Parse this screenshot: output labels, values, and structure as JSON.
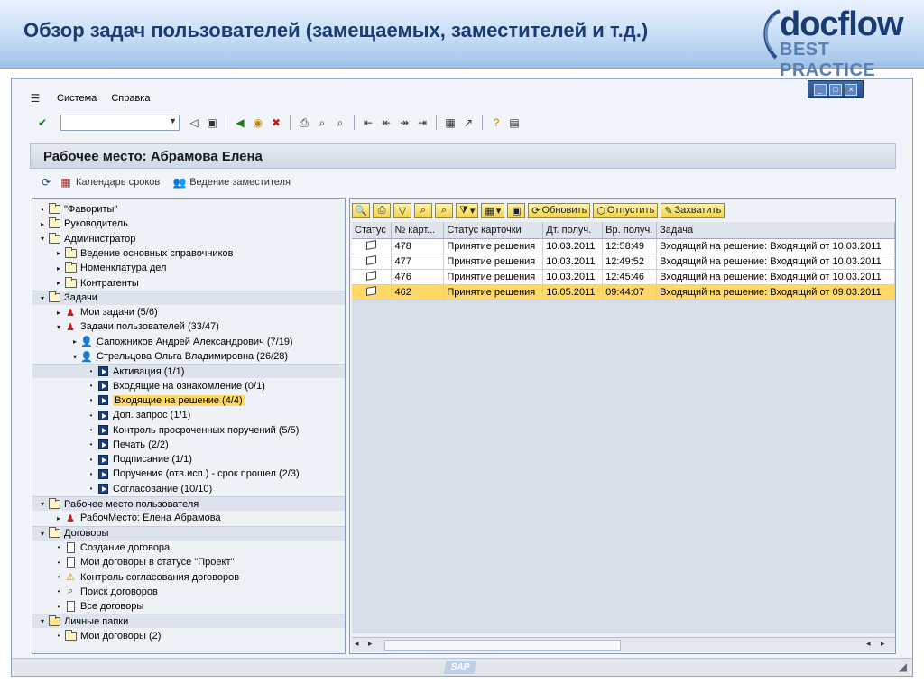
{
  "slide": {
    "title": "Обзор задач пользователей (замещаемых, заместителей и т.д.)",
    "logo_main": "docflow",
    "logo_sub": "BEST PRACTICE"
  },
  "menu": {
    "system": "Система",
    "help": "Справка"
  },
  "screen_title": "Рабочее место: Абрамова Елена",
  "app_toolbar": {
    "calendar": "Календарь сроков",
    "deputy": "Ведение заместителя"
  },
  "tree": [
    {
      "label": "\"Фавориты\"",
      "toggle": "•",
      "icon": "folder",
      "indent": 0,
      "group": false
    },
    {
      "label": "Руководитель",
      "toggle": "▸",
      "icon": "folder",
      "indent": 0,
      "group": false
    },
    {
      "label": "Администратор",
      "toggle": "▾",
      "icon": "folder",
      "indent": 0,
      "group": false
    },
    {
      "label": "Ведение основных справочников",
      "toggle": "▸",
      "icon": "folder",
      "indent": 1,
      "group": false
    },
    {
      "label": "Номенклатура дел",
      "toggle": "▸",
      "icon": "folder",
      "indent": 1,
      "group": false
    },
    {
      "label": "Контрагенты",
      "toggle": "▸",
      "icon": "folder",
      "indent": 1,
      "group": false
    },
    {
      "label": "Задачи",
      "toggle": "▾",
      "icon": "folder",
      "indent": 0,
      "group": true
    },
    {
      "label": "Мои задачи (5/6)",
      "toggle": "▸",
      "icon": "user-red",
      "indent": 1,
      "group": false
    },
    {
      "label": "Задачи пользователей (33/47)",
      "toggle": "▾",
      "icon": "user-red",
      "indent": 1,
      "group": false
    },
    {
      "label": "Сапожников Андрей Александрович (7/19)",
      "toggle": "▸",
      "icon": "user",
      "indent": 2,
      "group": false
    },
    {
      "label": "Стрельцова Ольга Владимировна (26/28)",
      "toggle": "▾",
      "icon": "user",
      "indent": 2,
      "group": false
    },
    {
      "label": "Активация (1/1)",
      "toggle": "•",
      "icon": "blue",
      "indent": 3,
      "group": true
    },
    {
      "label": "Входящие на ознакомление (0/1)",
      "toggle": "•",
      "icon": "blue",
      "indent": 3,
      "group": false
    },
    {
      "label": "Входящие на решение (4/4)",
      "toggle": "•",
      "icon": "blue",
      "indent": 3,
      "group": false,
      "selected": true
    },
    {
      "label": "Доп. запрос (1/1)",
      "toggle": "•",
      "icon": "blue",
      "indent": 3,
      "group": false
    },
    {
      "label": "Контроль просроченных поручений (5/5)",
      "toggle": "•",
      "icon": "blue",
      "indent": 3,
      "group": false
    },
    {
      "label": "Печать (2/2)",
      "toggle": "•",
      "icon": "blue",
      "indent": 3,
      "group": false
    },
    {
      "label": "Подписание (1/1)",
      "toggle": "•",
      "icon": "blue",
      "indent": 3,
      "group": false
    },
    {
      "label": "Поручения (отв.исп.) - срок прошел (2/3)",
      "toggle": "•",
      "icon": "blue",
      "indent": 3,
      "group": false
    },
    {
      "label": "Согласование (10/10)",
      "toggle": "•",
      "icon": "blue",
      "indent": 3,
      "group": false
    },
    {
      "label": "Рабочее место пользователя",
      "toggle": "▾",
      "icon": "folder",
      "indent": 0,
      "group": true
    },
    {
      "label": "РабочМесто: Елена Абрамова",
      "toggle": "▸",
      "icon": "user-red",
      "indent": 1,
      "group": false
    },
    {
      "label": "Договоры",
      "toggle": "▾",
      "icon": "folder",
      "indent": 0,
      "group": true
    },
    {
      "label": "Создание договора",
      "toggle": "•",
      "icon": "doc",
      "indent": 1,
      "group": false
    },
    {
      "label": "Мои договоры в статусе \"Проект\"",
      "toggle": "•",
      "icon": "doc",
      "indent": 1,
      "group": false
    },
    {
      "label": "Контроль согласования договоров",
      "toggle": "•",
      "icon": "warn",
      "indent": 1,
      "group": false
    },
    {
      "label": "Поиск договоров",
      "toggle": "•",
      "icon": "binoc",
      "indent": 1,
      "group": false
    },
    {
      "label": "Все договоры",
      "toggle": "•",
      "icon": "doc",
      "indent": 1,
      "group": false
    },
    {
      "label": "Личные папки",
      "toggle": "▾",
      "icon": "folder-open",
      "indent": 0,
      "group": true
    },
    {
      "label": "Мои договоры (2)",
      "toggle": "•",
      "icon": "folder",
      "indent": 1,
      "group": false
    }
  ],
  "grid_toolbar": {
    "refresh": "Обновить",
    "release": "Отпустить",
    "capture": "Захватить"
  },
  "grid": {
    "columns": [
      "Статус",
      "№ карт...",
      "Статус карточки",
      "Дт. получ.",
      "Вр. получ.",
      "Задача"
    ],
    "rows": [
      [
        "",
        "478",
        "Принятие решения",
        "10.03.2011",
        "12:58:49",
        "Входящий на решение: Входящий от 10.03.2011"
      ],
      [
        "",
        "477",
        "Принятие решения",
        "10.03.2011",
        "12:49:52",
        "Входящий на решение: Входящий от 10.03.2011"
      ],
      [
        "",
        "476",
        "Принятие решения",
        "10.03.2011",
        "12:45:46",
        "Входящий на решение: Входящий от 10.03.2011"
      ],
      [
        "",
        "462",
        "Принятие решения",
        "16.05.2011",
        "09:44:07",
        "Входящий на решение: Входящий от 09.03.2011"
      ]
    ],
    "selected_row": 3
  },
  "status_bar": {
    "logo": "SAP"
  }
}
